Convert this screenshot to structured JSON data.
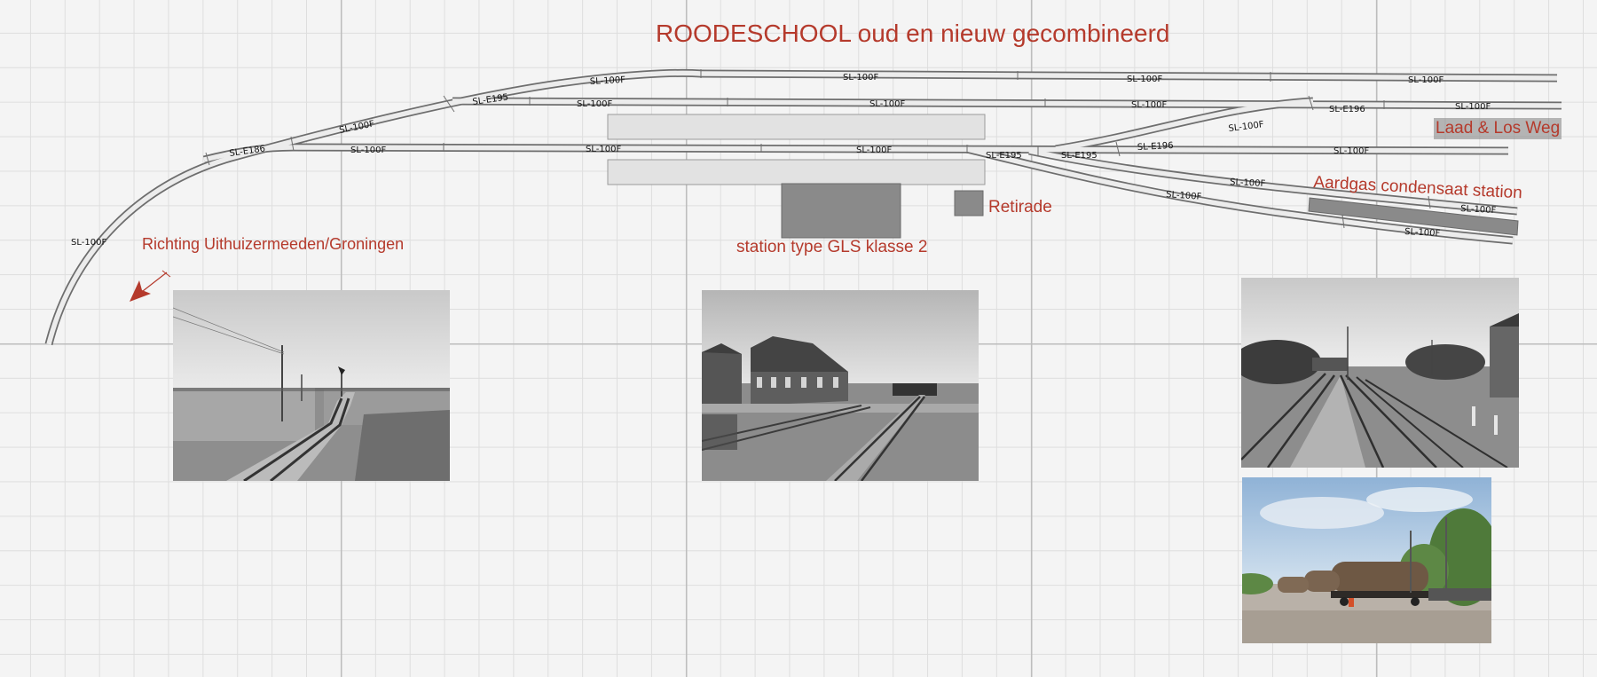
{
  "title": "ROODESCHOOL oud en nieuw gecombineerd",
  "labels": {
    "direction": "Richting Uithuizermeeden/Groningen",
    "station": "station type GLS klasse 2",
    "retirade": "Retirade",
    "laad_los": "Laad & Los Weg",
    "aardgas": "Aardgas condensaat station"
  },
  "track_labels": {
    "curve": "SL-100F",
    "e186": "SL-E186",
    "upper_curve": "SL-100F",
    "e195_upper": "SL-E195",
    "top_1": "SL-100F",
    "top_2": "SL-100F",
    "top_3": "SL-100F",
    "top_4": "SL-100F",
    "second_1": "SL-100F",
    "second_2": "SL-100F",
    "second_3": "SL-100F",
    "second_4": "SL-100F",
    "e196_right": "SL-E196",
    "main_1": "SL-100F",
    "main_2": "SL-100F",
    "main_3": "SL-100F",
    "e195_a": "SL-E195",
    "e195_b": "SL-E195",
    "e196_mid": "SL-E196",
    "branch_up": "SL-100F",
    "main_4": "SL-100F",
    "siding_a": "SL-100F",
    "siding_b": "SL-100F",
    "siding_c": "SL-100F",
    "siding_d": "SL-100F"
  },
  "colors": {
    "label_red": "#b53a2c",
    "track_fill": "#ececec",
    "track_edge": "#6e6e6e",
    "platform": "#e2e2e2",
    "building": "#8a8a8a"
  },
  "icons": {
    "direction_arrow": "arrow-icon"
  }
}
